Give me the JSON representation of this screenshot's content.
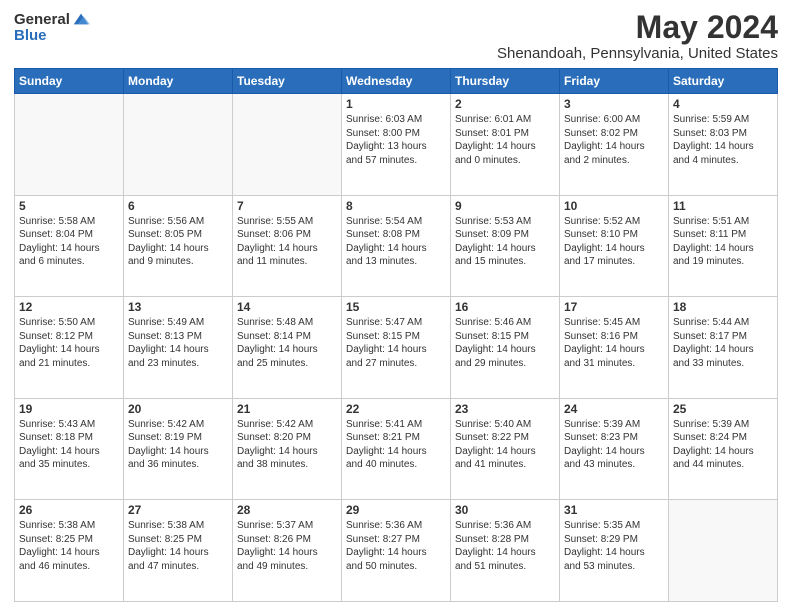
{
  "logo": {
    "general": "General",
    "blue": "Blue"
  },
  "title": "May 2024",
  "subtitle": "Shenandoah, Pennsylvania, United States",
  "days_of_week": [
    "Sunday",
    "Monday",
    "Tuesday",
    "Wednesday",
    "Thursday",
    "Friday",
    "Saturday"
  ],
  "weeks": [
    [
      {
        "day": "",
        "sunrise": "",
        "sunset": "",
        "daylight": "",
        "empty": true
      },
      {
        "day": "",
        "sunrise": "",
        "sunset": "",
        "daylight": "",
        "empty": true
      },
      {
        "day": "",
        "sunrise": "",
        "sunset": "",
        "daylight": "",
        "empty": true
      },
      {
        "day": "1",
        "sunrise": "Sunrise: 6:03 AM",
        "sunset": "Sunset: 8:00 PM",
        "daylight": "Daylight: 13 hours and 57 minutes."
      },
      {
        "day": "2",
        "sunrise": "Sunrise: 6:01 AM",
        "sunset": "Sunset: 8:01 PM",
        "daylight": "Daylight: 14 hours and 0 minutes."
      },
      {
        "day": "3",
        "sunrise": "Sunrise: 6:00 AM",
        "sunset": "Sunset: 8:02 PM",
        "daylight": "Daylight: 14 hours and 2 minutes."
      },
      {
        "day": "4",
        "sunrise": "Sunrise: 5:59 AM",
        "sunset": "Sunset: 8:03 PM",
        "daylight": "Daylight: 14 hours and 4 minutes."
      }
    ],
    [
      {
        "day": "5",
        "sunrise": "Sunrise: 5:58 AM",
        "sunset": "Sunset: 8:04 PM",
        "daylight": "Daylight: 14 hours and 6 minutes."
      },
      {
        "day": "6",
        "sunrise": "Sunrise: 5:56 AM",
        "sunset": "Sunset: 8:05 PM",
        "daylight": "Daylight: 14 hours and 9 minutes."
      },
      {
        "day": "7",
        "sunrise": "Sunrise: 5:55 AM",
        "sunset": "Sunset: 8:06 PM",
        "daylight": "Daylight: 14 hours and 11 minutes."
      },
      {
        "day": "8",
        "sunrise": "Sunrise: 5:54 AM",
        "sunset": "Sunset: 8:08 PM",
        "daylight": "Daylight: 14 hours and 13 minutes."
      },
      {
        "day": "9",
        "sunrise": "Sunrise: 5:53 AM",
        "sunset": "Sunset: 8:09 PM",
        "daylight": "Daylight: 14 hours and 15 minutes."
      },
      {
        "day": "10",
        "sunrise": "Sunrise: 5:52 AM",
        "sunset": "Sunset: 8:10 PM",
        "daylight": "Daylight: 14 hours and 17 minutes."
      },
      {
        "day": "11",
        "sunrise": "Sunrise: 5:51 AM",
        "sunset": "Sunset: 8:11 PM",
        "daylight": "Daylight: 14 hours and 19 minutes."
      }
    ],
    [
      {
        "day": "12",
        "sunrise": "Sunrise: 5:50 AM",
        "sunset": "Sunset: 8:12 PM",
        "daylight": "Daylight: 14 hours and 21 minutes."
      },
      {
        "day": "13",
        "sunrise": "Sunrise: 5:49 AM",
        "sunset": "Sunset: 8:13 PM",
        "daylight": "Daylight: 14 hours and 23 minutes."
      },
      {
        "day": "14",
        "sunrise": "Sunrise: 5:48 AM",
        "sunset": "Sunset: 8:14 PM",
        "daylight": "Daylight: 14 hours and 25 minutes."
      },
      {
        "day": "15",
        "sunrise": "Sunrise: 5:47 AM",
        "sunset": "Sunset: 8:15 PM",
        "daylight": "Daylight: 14 hours and 27 minutes."
      },
      {
        "day": "16",
        "sunrise": "Sunrise: 5:46 AM",
        "sunset": "Sunset: 8:15 PM",
        "daylight": "Daylight: 14 hours and 29 minutes."
      },
      {
        "day": "17",
        "sunrise": "Sunrise: 5:45 AM",
        "sunset": "Sunset: 8:16 PM",
        "daylight": "Daylight: 14 hours and 31 minutes."
      },
      {
        "day": "18",
        "sunrise": "Sunrise: 5:44 AM",
        "sunset": "Sunset: 8:17 PM",
        "daylight": "Daylight: 14 hours and 33 minutes."
      }
    ],
    [
      {
        "day": "19",
        "sunrise": "Sunrise: 5:43 AM",
        "sunset": "Sunset: 8:18 PM",
        "daylight": "Daylight: 14 hours and 35 minutes."
      },
      {
        "day": "20",
        "sunrise": "Sunrise: 5:42 AM",
        "sunset": "Sunset: 8:19 PM",
        "daylight": "Daylight: 14 hours and 36 minutes."
      },
      {
        "day": "21",
        "sunrise": "Sunrise: 5:42 AM",
        "sunset": "Sunset: 8:20 PM",
        "daylight": "Daylight: 14 hours and 38 minutes."
      },
      {
        "day": "22",
        "sunrise": "Sunrise: 5:41 AM",
        "sunset": "Sunset: 8:21 PM",
        "daylight": "Daylight: 14 hours and 40 minutes."
      },
      {
        "day": "23",
        "sunrise": "Sunrise: 5:40 AM",
        "sunset": "Sunset: 8:22 PM",
        "daylight": "Daylight: 14 hours and 41 minutes."
      },
      {
        "day": "24",
        "sunrise": "Sunrise: 5:39 AM",
        "sunset": "Sunset: 8:23 PM",
        "daylight": "Daylight: 14 hours and 43 minutes."
      },
      {
        "day": "25",
        "sunrise": "Sunrise: 5:39 AM",
        "sunset": "Sunset: 8:24 PM",
        "daylight": "Daylight: 14 hours and 44 minutes."
      }
    ],
    [
      {
        "day": "26",
        "sunrise": "Sunrise: 5:38 AM",
        "sunset": "Sunset: 8:25 PM",
        "daylight": "Daylight: 14 hours and 46 minutes."
      },
      {
        "day": "27",
        "sunrise": "Sunrise: 5:38 AM",
        "sunset": "Sunset: 8:25 PM",
        "daylight": "Daylight: 14 hours and 47 minutes."
      },
      {
        "day": "28",
        "sunrise": "Sunrise: 5:37 AM",
        "sunset": "Sunset: 8:26 PM",
        "daylight": "Daylight: 14 hours and 49 minutes."
      },
      {
        "day": "29",
        "sunrise": "Sunrise: 5:36 AM",
        "sunset": "Sunset: 8:27 PM",
        "daylight": "Daylight: 14 hours and 50 minutes."
      },
      {
        "day": "30",
        "sunrise": "Sunrise: 5:36 AM",
        "sunset": "Sunset: 8:28 PM",
        "daylight": "Daylight: 14 hours and 51 minutes."
      },
      {
        "day": "31",
        "sunrise": "Sunrise: 5:35 AM",
        "sunset": "Sunset: 8:29 PM",
        "daylight": "Daylight: 14 hours and 53 minutes."
      },
      {
        "day": "",
        "sunrise": "",
        "sunset": "",
        "daylight": "",
        "empty": true
      }
    ]
  ]
}
